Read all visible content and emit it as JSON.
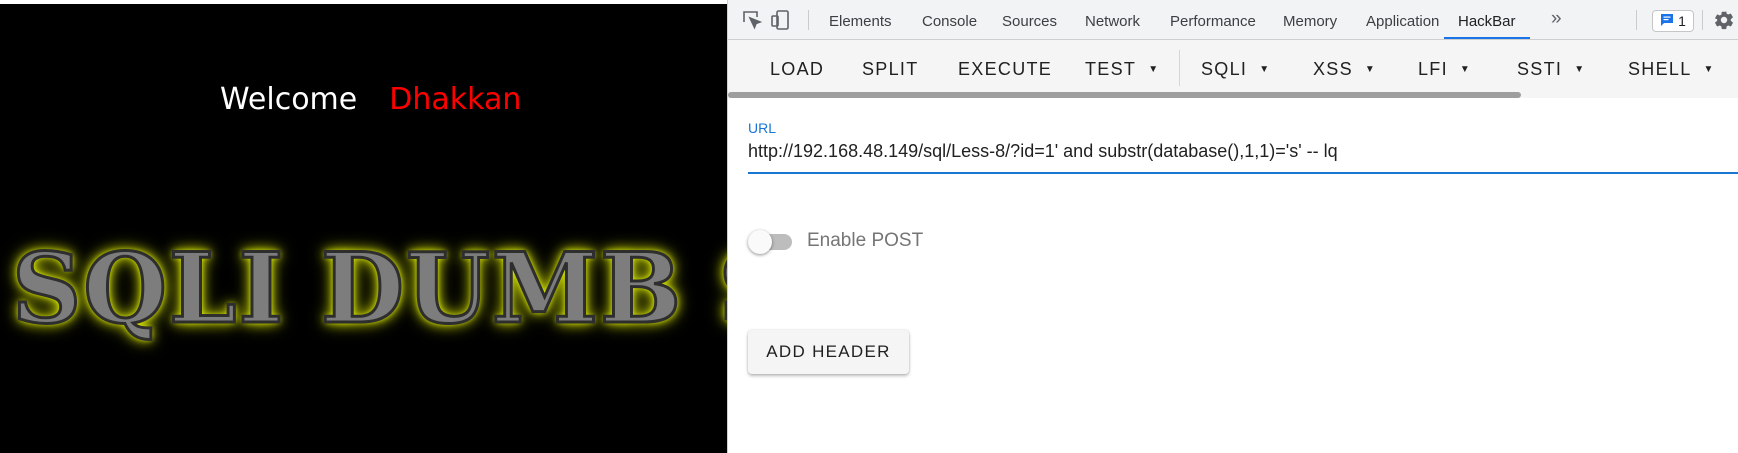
{
  "page": {
    "welcome_text": "Welcome",
    "user_name": "Dhakkan",
    "banner_text": "SQLI DUMB SERIES"
  },
  "devtools": {
    "tabs": [
      {
        "label": "Elements"
      },
      {
        "label": "Console"
      },
      {
        "label": "Sources"
      },
      {
        "label": "Network"
      },
      {
        "label": "Performance"
      },
      {
        "label": "Memory"
      },
      {
        "label": "Application"
      },
      {
        "label": "HackBar",
        "active": true
      }
    ],
    "more_tabs": "»",
    "issues_count": "1"
  },
  "hackbar": {
    "buttons": {
      "load": "LOAD",
      "split": "SPLIT",
      "execute": "EXECUTE",
      "test": "TEST",
      "sqli": "SQLI",
      "xss": "XSS",
      "lfi": "LFI",
      "ssti": "SSTI",
      "shell": "SHELL"
    },
    "url_label": "URL",
    "url_value": "http://192.168.48.149/sql/Less-8/?id=1' and substr(database(),1,1)='s' -- lq",
    "enable_post_label": "Enable POST",
    "enable_post": false,
    "add_header_label": "ADD HEADER"
  },
  "colors": {
    "accent": "#1a73e8",
    "hackbar_blue": "#1976d2",
    "welcome_name": "#ff0000",
    "banner_glow": "#f0ff00"
  }
}
